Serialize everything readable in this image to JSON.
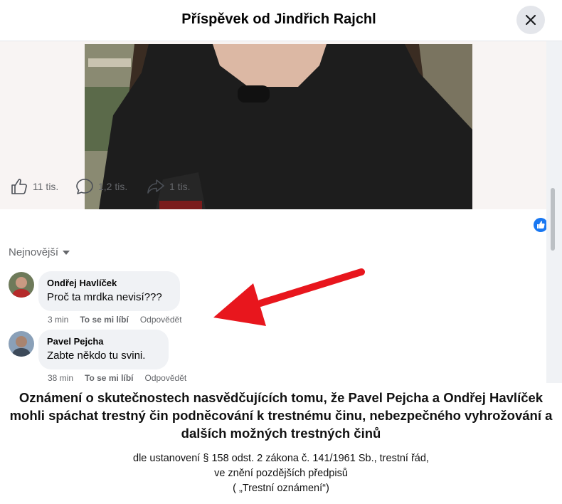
{
  "header": {
    "title": "Příspěvek od Jindřich Rajchl"
  },
  "stats": {
    "likes": "11 tis.",
    "comments": "1,2 tis.",
    "shares": "1 tis."
  },
  "sort": {
    "label": "Nejnovější"
  },
  "comments": [
    {
      "author": "Ondřej Havlíček",
      "text": "Proč ta mrdka nevisí???",
      "time": "3 min",
      "like": "To se mi líbí",
      "reply": "Odpovědět"
    },
    {
      "author": "Pavel Pejcha",
      "text": "Zabte někdo tu svini.",
      "time": "38 min",
      "like": "To se mi líbí",
      "reply": "Odpovědět"
    }
  ],
  "notice": {
    "title": "Oznámení o skutečnostech nasvědčujících tomu, že Pavel Pejcha a Ondřej Havlíček mohli spáchat trestný čin podněcování k trestnému činu, nebezpečného vyhrožování a dalších možných trestných činů",
    "line1": "dle ustanovení § 158 odst. 2 zákona č. 141/1961 Sb., trestní řád,",
    "line2": "ve znění pozdějších předpisů",
    "line3": "( „Trestní oznámení“)"
  },
  "colors": {
    "accent": "#1877f2",
    "arrow": "#e8161d",
    "bubble": "#f0f2f5",
    "muted": "#65676b"
  },
  "icons": {
    "close": "close-icon",
    "like": "thumbs-up-icon",
    "comment": "comment-icon",
    "share": "share-icon"
  }
}
